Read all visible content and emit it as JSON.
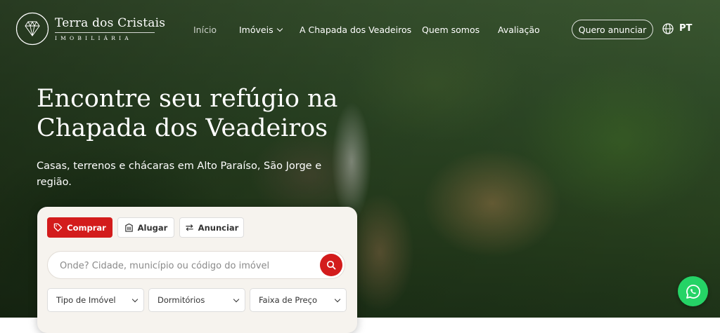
{
  "brand": {
    "name": "Terra dos Cristais",
    "tagline": "IMOBILIÁRIA"
  },
  "nav": {
    "items": [
      {
        "label": "Início"
      },
      {
        "label": "Imóveis"
      },
      {
        "label": "A Chapada dos Veadeiros"
      },
      {
        "label": "Quem somos"
      },
      {
        "label": "Avaliação"
      }
    ],
    "cta": "Quero anunciar",
    "language": "PT"
  },
  "hero": {
    "title_line1": "Encontre seu refúgio na",
    "title_line2": "Chapada dos Veadeiros",
    "subtitle": "Casas, terrenos e chácaras em Alto Paraíso, São Jorge e região."
  },
  "search": {
    "tabs": [
      {
        "label": "Comprar",
        "icon": "tag-icon",
        "active": true
      },
      {
        "label": "Alugar",
        "icon": "building-icon",
        "active": false
      },
      {
        "label": "Anunciar",
        "icon": "swap-icon",
        "active": false
      }
    ],
    "placeholder": "Onde? Cidade, município ou código do imóvel",
    "filters": [
      {
        "label": "Tipo de Imóvel"
      },
      {
        "label": "Dormitórios"
      },
      {
        "label": "Faixa de Preço"
      }
    ]
  },
  "colors": {
    "accent": "#d31c1c",
    "whatsapp": "#25d366",
    "card_bg": "#f6f3ee"
  },
  "icons": {
    "brand": "crystal-logo-icon",
    "globe": "globe-icon",
    "search": "search-icon",
    "chat": "whatsapp-icon"
  }
}
